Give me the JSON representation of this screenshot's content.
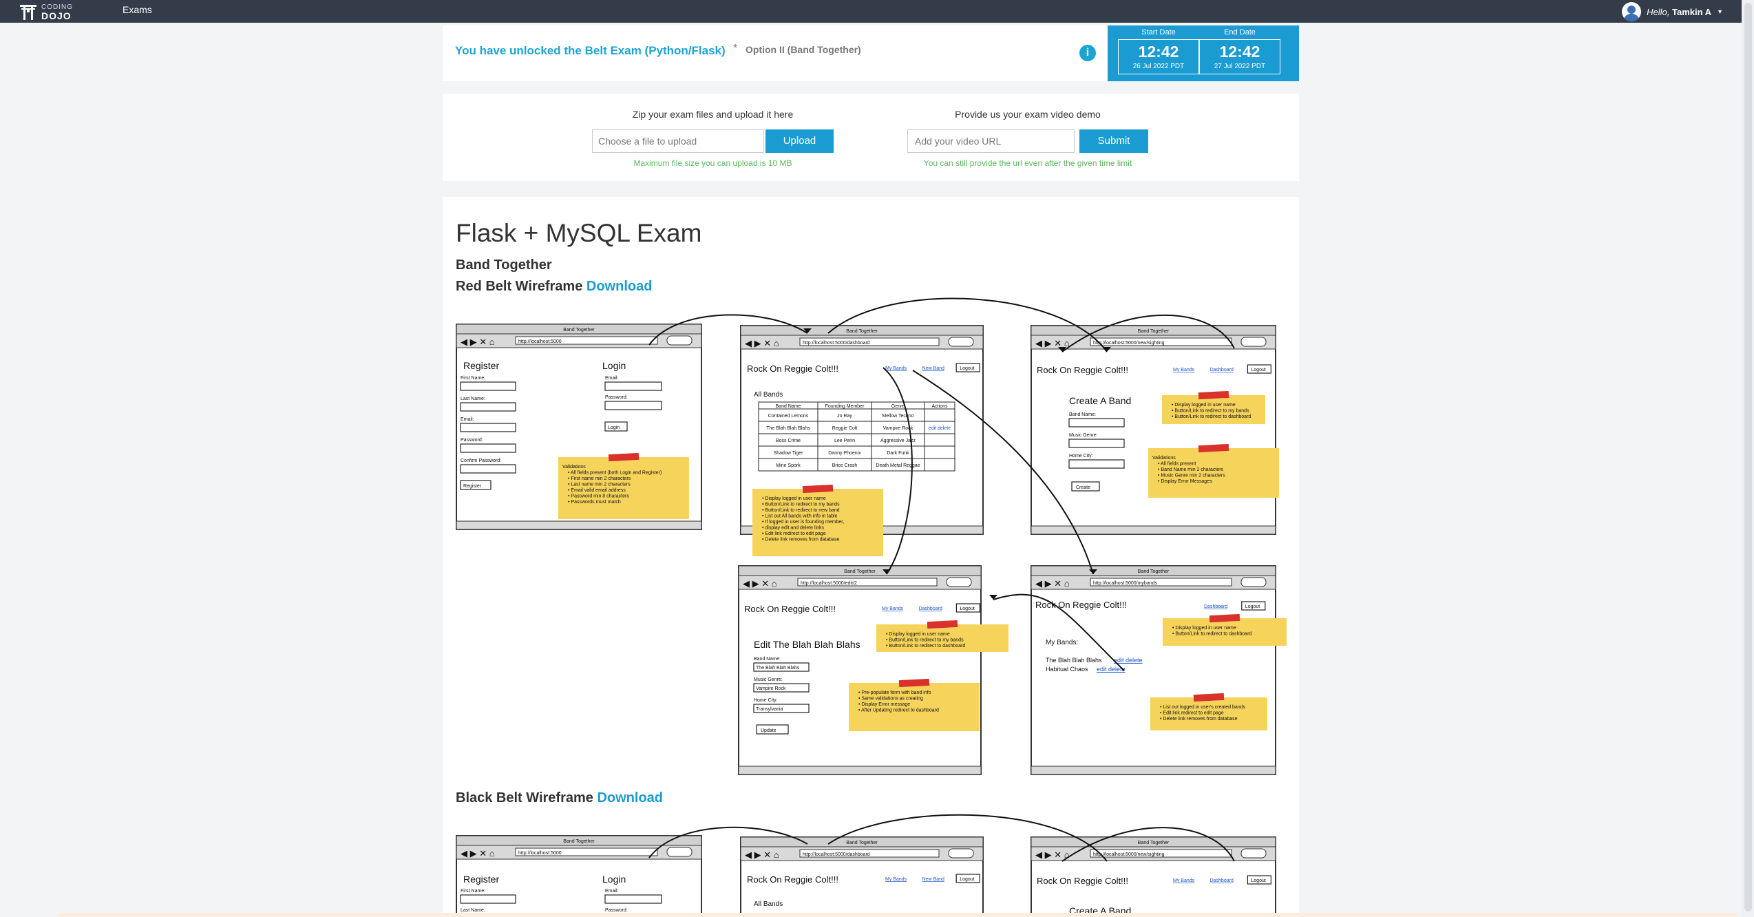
{
  "nav": {
    "logo_top": "CODING",
    "logo_bottom": "DOJO",
    "exams_link": "Exams",
    "hello": "Hello,",
    "user_name": "Tamkin A"
  },
  "exam_header": {
    "unlock_title": "You have unlocked the Belt Exam (Python/Flask)",
    "separator": "*",
    "option": "Option II (Band Together)",
    "start_label": "Start Date",
    "start_time": "12:42",
    "start_date": "26 Jul 2022 PDT",
    "end_label": "End Date",
    "end_time": "12:42",
    "end_date": "27 Jul 2022 PDT"
  },
  "upload": {
    "zip_title": "Zip your exam files and upload it here",
    "file_placeholder": "Choose a file to upload",
    "upload_button": "Upload",
    "file_hint": "Maximum file size you can upload is 10 MB",
    "video_title": "Provide us your exam video demo",
    "video_placeholder": "Add your video URL",
    "submit_button": "Submit",
    "video_hint": "You can still provide the url even after the given time limit"
  },
  "content": {
    "title": "Flask + MySQL Exam",
    "subtitle": "Band Together",
    "red_belt_label": "Red Belt Wireframe",
    "black_belt_label": "Black Belt Wireframe",
    "download": "Download"
  },
  "wireframe": {
    "window_title": "Band Together",
    "app_header": "Rock On Reggie Colt!!!",
    "urls": {
      "home": "http://localhost:5000",
      "dashboard": "http://localhost:5000/dashboard",
      "new_band": "http://localhost:5000/new/sighting",
      "edit": "http://localhost:5000/edit/2",
      "mybands": "http://localhost:5000/mybands"
    },
    "register": {
      "heading": "Register",
      "fields": [
        "First Name:",
        "Last Name:",
        "Email:",
        "Password:",
        "Confirm Password:"
      ],
      "button": "Register"
    },
    "login": {
      "heading": "Login",
      "fields": [
        "Email:",
        "Password:"
      ],
      "button": "Login"
    },
    "validation_note": [
      "Validations",
      "All fields present (both Login and Register)",
      "First name min 2 characters",
      "Last name min 2 characters",
      "Email valid email address",
      "Password min 8 characters",
      "Passwords must match"
    ],
    "links": {
      "my_bands": "My Bands",
      "new_band": "New Band",
      "dashboard": "Dashboard",
      "logout": "Logout"
    },
    "dashboard": {
      "all_bands": "All Bands",
      "columns": [
        "Band Name",
        "Founding Member",
        "Genre",
        "Actions"
      ],
      "rows": [
        [
          "Contained Lemons",
          "Jo Ray",
          "Mellow Techno",
          ""
        ],
        [
          "The Blah Blah Blahs",
          "Reggie Colt",
          "Vampire Rock",
          "edit delete"
        ],
        [
          "Boss Crime",
          "Lee Penn",
          "Aggressive Jazz",
          ""
        ],
        [
          "Shadow Tiger",
          "Danny Phoenix",
          "Dark Funk",
          ""
        ],
        [
          "Mine Spork",
          "Brice Crash",
          "Death Metal Reggae",
          ""
        ]
      ],
      "note": [
        "Display logged in user name",
        "Button/Link to redirect to my bands",
        "Button/Link to redirect to new band",
        "List out All bands with info in table",
        "If logged in user is founding member,",
        "display edit and delete links",
        "Edit link redirect to edit page",
        "Delete link removes from database"
      ]
    },
    "create_band": {
      "heading": "Create A Band",
      "fields": [
        "Band Name:",
        "Music Genre:",
        "Home City:"
      ],
      "button": "Create",
      "note_top": [
        "Display logged in user name",
        "Button/Link to redirect to my bands",
        "Button/Link to redirect to dashboard"
      ],
      "note_bottom": [
        "Validations",
        "All fields present",
        "Band Name min 2 characters",
        "Music Genre min 2 characters",
        "Display Error Messages"
      ]
    },
    "edit_band": {
      "heading": "Edit The Blah Blah Blahs",
      "fields": [
        "Band Name:",
        "Music Genre:",
        "Home City:"
      ],
      "values": [
        "The Blah Blah Blahs",
        "Vampire Rock",
        "Transylvania"
      ],
      "button": "Update",
      "note_top": [
        "Display logged in user name",
        "Button/Link to redirect to my bands",
        "Button/Link to redirect to dashboard"
      ],
      "note_bottom": [
        "Pre-populate form with band info",
        "Same validations as creating",
        "Display Error message",
        "After Updating redirect to dashboard"
      ]
    },
    "my_bands": {
      "heading": "My Bands:",
      "rows": [
        "The Blah Blah Blahs",
        "Habitual Chaos"
      ],
      "edit": "edit",
      "delete": "delete",
      "note_top": [
        "Display logged in user name",
        "Button/Link to redirect to dashboard"
      ],
      "note_bottom": [
        "List out logged in user's created bands",
        "Edit link redirect to edit page",
        "Delete link removes from database"
      ]
    }
  },
  "colors": {
    "nav_bg": "#343c4a",
    "accent": "#1a9bd1",
    "hint_green": "#5cb85c",
    "sticky": "#f6d35b",
    "tape": "#d9322c"
  }
}
